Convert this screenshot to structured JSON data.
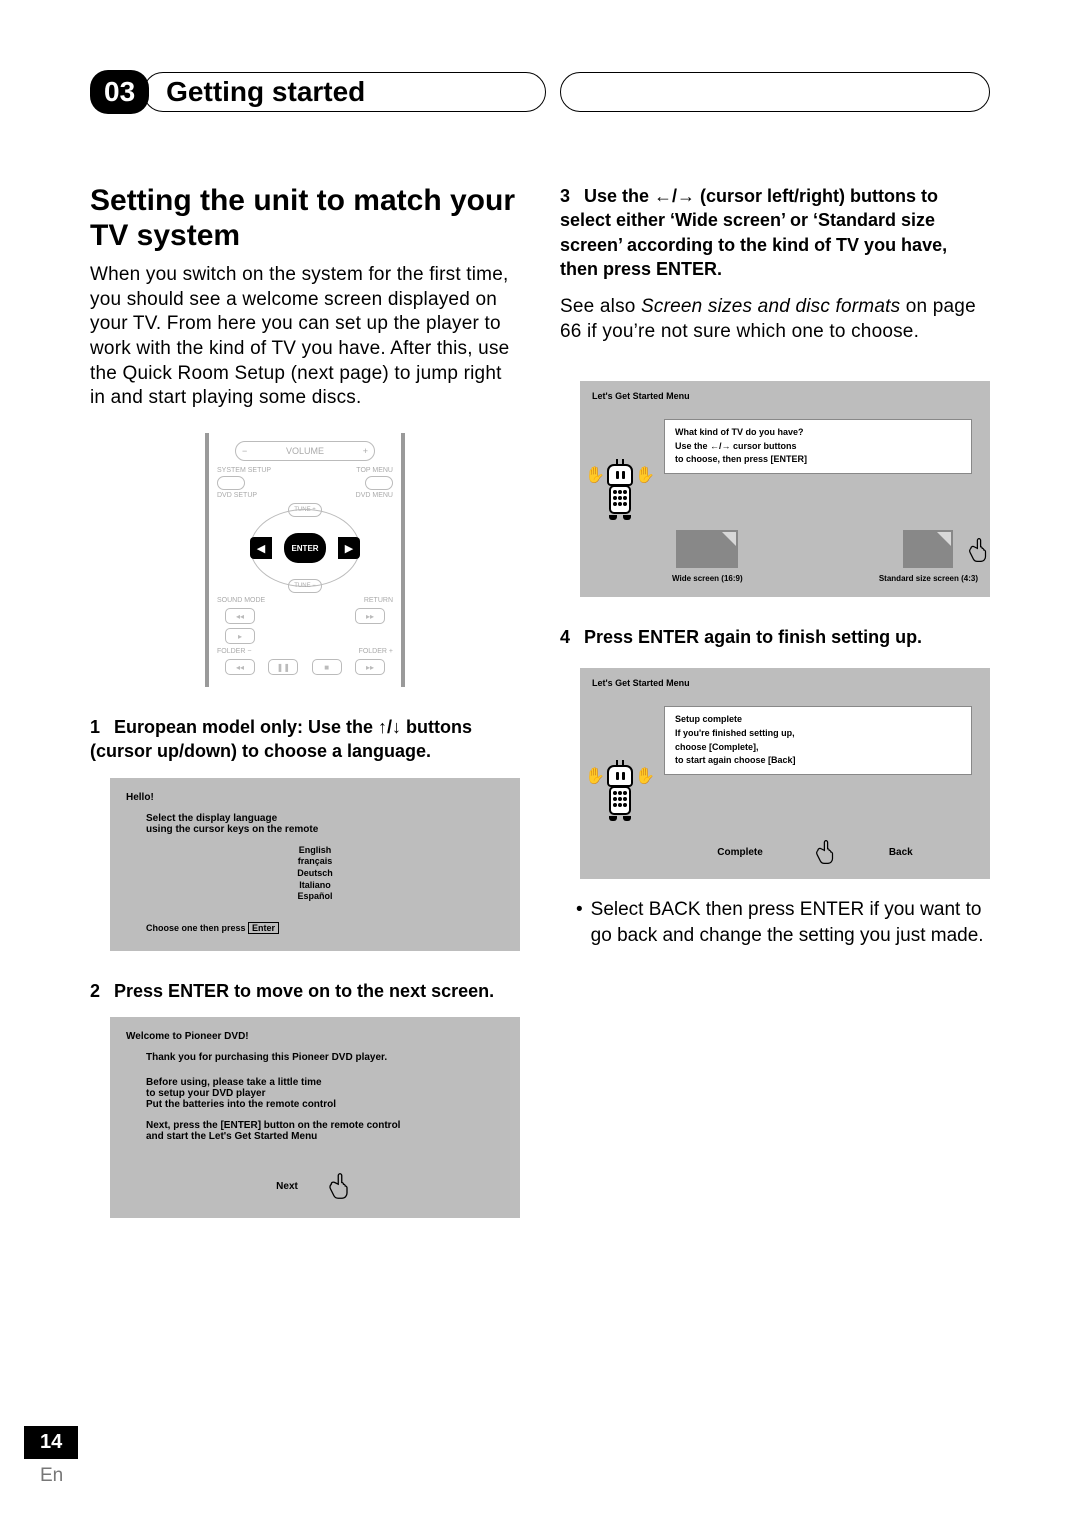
{
  "header": {
    "chapter": "03",
    "title": "Getting started"
  },
  "left": {
    "h1": "Setting the unit to match your TV system",
    "intro": "When you switch on the system for the first time, you should see a welcome screen displayed on your TV. From here you can set up the player to work with the kind of TV you have. After this, use the Quick Room Setup (next page) to jump right in and start playing some discs.",
    "remote": {
      "volume": "VOLUME",
      "minus": "−",
      "plus": "+",
      "systemSetup": "SYSTEM SETUP",
      "topMenu": "TOP MENU",
      "dvdSetup": "DVD SETUP",
      "dvdMenu": "DVD MENU",
      "enter": "ENTER",
      "tunePlus": "TUNE +",
      "tuneMinus": "TUNE −",
      "soundMode": "SOUND MODE",
      "return": "RETURN",
      "folderMinus": "FOLDER −",
      "folderPlus": "FOLDER +"
    },
    "step1_num": "1",
    "step1": "European model only: Use the ↑/↓ buttons (cursor up/down) to choose a language.",
    "screen1": {
      "title": "Hello!",
      "line1": "Select the display language",
      "line2": "using the cursor keys on the remote",
      "lang1": "English",
      "lang2": "français",
      "lang3": "Deutsch",
      "lang4": "Italiano",
      "lang5": "Español",
      "foot_a": "Choose one then press",
      "foot_b": "Enter"
    },
    "step2_num": "2",
    "step2": "Press ENTER to move on to the next screen.",
    "screen2": {
      "title": "Welcome to Pioneer DVD!",
      "l1": "Thank you for purchasing this Pioneer DVD player.",
      "l2": "Before using, please take a little time",
      "l3": "to setup your DVD player",
      "l4": "Put the batteries into the remote control",
      "l5": "Next, press the [ENTER] button on the remote control",
      "l6": "and start the Let's Get Started Menu",
      "next": "Next"
    }
  },
  "right": {
    "step3_num": "3",
    "step3_a": "Use the ←/→ (cursor left/right) buttons to select either ‘Wide screen’ or ‘Standard size screen’ according to the kind of TV you have, then press ENTER.",
    "step3_b_a": "See also ",
    "step3_b_i": "Screen sizes and disc formats",
    "step3_b_b": " on page 66 if you’re not sure which one to choose.",
    "screen3": {
      "title": "Let's Get Started Menu",
      "q1": "What kind of TV do you have?",
      "q2": "Use the ←/→ cursor buttons",
      "q3": "to choose, then press [ENTER]",
      "opt1": "Wide screen (16:9)",
      "opt2": "Standard size screen (4:3)"
    },
    "step4_num": "4",
    "step4": "Press ENTER again to finish setting up.",
    "screen4": {
      "title": "Let's Get Started Menu",
      "l1": "Setup complete",
      "l2": "If you're finished setting up,",
      "l3": "choose [Complete],",
      "l4": "to start again choose [Back]",
      "opt1": "Complete",
      "opt2": "Back"
    },
    "bullet": {
      "a": "Select ",
      "b": "BACK",
      "c": " then press ",
      "d": "ENTER",
      "e": " if you want to go back and change the setting you just made."
    }
  },
  "footer": {
    "page": "14",
    "lang": "En"
  }
}
